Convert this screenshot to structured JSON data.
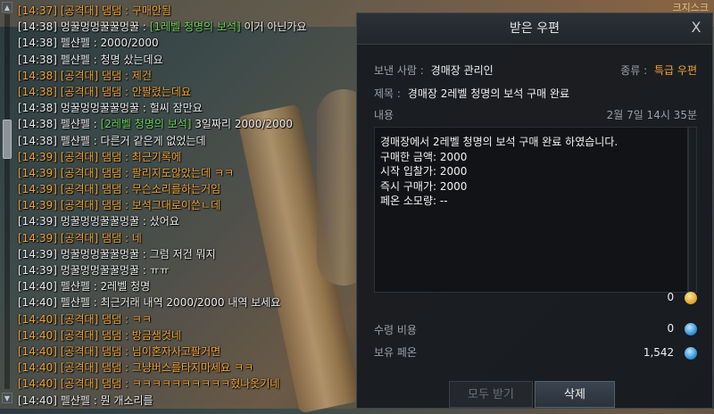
{
  "corner_text": "크지스크",
  "chat": {
    "lines": [
      {
        "text": "[14:37] [공격대] 댐댐 : 구매안됨",
        "kind": "guild"
      },
      {
        "pre": "[14:38] 멍꿀멍멍꿀꿀멍꿀 : ",
        "item": "[1레벨 청명의 보석]",
        "post": " 이거 아닌가요",
        "kind": "normal"
      },
      {
        "text": "[14:38] 펠샨펠 : 2000/2000",
        "kind": "normal"
      },
      {
        "text": "[14:38] 펠샨펠 : 청명 샀는데요",
        "kind": "normal"
      },
      {
        "text": "[14:38] [공격대] 댐댐 : 제건",
        "kind": "guild"
      },
      {
        "text": "[14:38] [공격대] 댐댐 : 안팔렸는데요",
        "kind": "guild"
      },
      {
        "text": "[14:38] 멍꿀멍멍꿀꿀멍꿀 : 헐씨 잠만요",
        "kind": "normal"
      },
      {
        "pre": "[14:38] 펠샨펠 : ",
        "item": "[2레벨 청명의 보석]",
        "post": " 3일짜리 2000/2000",
        "kind": "normal"
      },
      {
        "text": "[14:38] 펠샨펠 : 다른거 같은게 없었는데",
        "kind": "normal"
      },
      {
        "text": "[14:39] [공격대] 댐댐 : 최근기록에",
        "kind": "guild"
      },
      {
        "text": "[14:39] [공격대] 댐댐 : 팔리지도않았는데 ㅋㅋ",
        "kind": "guild"
      },
      {
        "text": "[14:39] [공격대] 댐댐 : 무슨소리를하는거임",
        "kind": "guild"
      },
      {
        "text": "[14:39] [공격대] 댐댐 : 보석그대로이쓴ㄴ데",
        "kind": "guild"
      },
      {
        "text": "[14:39] 멍꿀멍멍꿀꿀멍꿀 : 샀어요",
        "kind": "normal"
      },
      {
        "text": "[14:39] [공격대] 댐댐 : 네",
        "kind": "guild"
      },
      {
        "text": "[14:39] 멍꿀멍멍꿀꿀멍꿀 : 그럼 저건 뭐지",
        "kind": "normal"
      },
      {
        "text": "[14:39] 멍꿀멍멍꿀꿀멍꿀 : ㅠㅠ",
        "kind": "normal"
      },
      {
        "text": "[14:40] 펠샨펠 : 2레벨 청명",
        "kind": "normal"
      },
      {
        "text": "[14:40] 펠샨펠 : 최근거래 내역 2000/2000 내역 보세요",
        "kind": "normal"
      },
      {
        "text": "[14:40] [공격대] 댐댐 : ㅋㅋ",
        "kind": "guild"
      },
      {
        "text": "[14:40] [공격대] 댐댐 : 방금샘것네",
        "kind": "guild"
      },
      {
        "text": "[14:40] [공격대] 댐댐 : 님이혼자사고팔거면",
        "kind": "guild"
      },
      {
        "text": "[14:40] [공격대] 댐댐 : 그냥버스를타지마세요 ㅋㅋ",
        "kind": "guild"
      },
      {
        "text": "[14:40] [공격대] 댐댐 : ㅋㅋㅋㅋㅋㅋㅋㅋㅋㅋ혔나옷기네",
        "kind": "guild"
      },
      {
        "text": "[14:40] 펠샨펠 : 뭔 개소리를",
        "kind": "normal"
      }
    ]
  },
  "mail": {
    "title": "받은 우편",
    "close": "X",
    "sender_label": "보낸 사람 :",
    "sender": "경매장 관리인",
    "type_label": "종류 :",
    "type": "특급 우편",
    "subject_label": "제목 :",
    "subject": "경매장 2레벨 청명의 보석 구매 완료",
    "content_label": "내용",
    "date": "2월 7일 14시 35분",
    "body": [
      "경매장에서 2레벨 청명의 보석 구매 완료 하였습니다.",
      "구매한 금액: 2000",
      "시작 입찰가: 2000",
      "즉시 구매가: 2000",
      "페온 소모량: --"
    ],
    "gold_amount": "0",
    "fee_label": "수령 비용",
    "fee_amount": "0",
    "held_label": "보유 페온",
    "held_amount": "1,542",
    "receive_all": "모두 받기",
    "delete": "삭제"
  }
}
